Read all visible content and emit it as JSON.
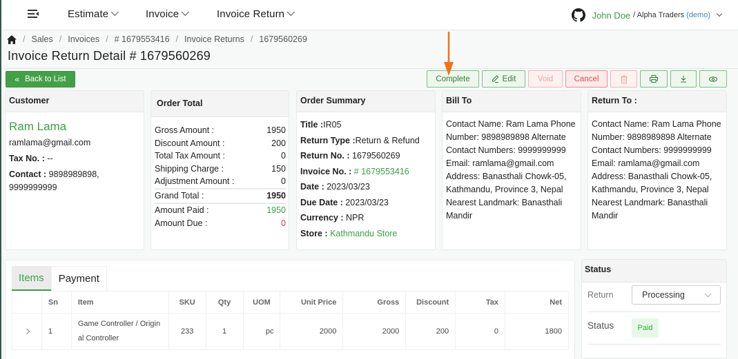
{
  "topnav": {
    "menus": [
      {
        "label": "Estimate"
      },
      {
        "label": "Invoice"
      },
      {
        "label": "Invoice Return"
      }
    ],
    "user": {
      "name": "John Doe",
      "org": "/ Alpha Traders",
      "demo": "(demo)"
    }
  },
  "breadcrumb": [
    "Sales",
    "Invoices",
    "# 1679553416",
    "Invoice Returns",
    "1679560269"
  ],
  "page_title": "Invoice Return Detail # 1679560269",
  "toolbar": {
    "back_label": "Back to List",
    "complete_label": "Complete",
    "edit_label": "Edit",
    "void_label": "Void",
    "cancel_label": "Cancel"
  },
  "customer": {
    "heading": "Customer",
    "name": "Ram Lama",
    "email": "ramlama@gmail.com",
    "tax_label": "Tax No. :",
    "tax_value": " --",
    "contact_label": "Contact :",
    "contact_value": " 9898989898, 9999999999"
  },
  "order_total": {
    "heading": "Order Total",
    "rows": [
      {
        "label": "Gross Amount :",
        "value": "1950"
      },
      {
        "label": "Discount Amount :",
        "value": "200"
      },
      {
        "label": "Total Tax Amount :",
        "value": "0"
      },
      {
        "label": "Shipping Charge :",
        "value": "150"
      },
      {
        "label": "Adjustment Amount :",
        "value": "0"
      }
    ],
    "grand_total": {
      "label": "Grand Total :",
      "value": "1950"
    },
    "amount_paid": {
      "label": "Amount Paid :",
      "value": "1950"
    },
    "amount_due": {
      "label": "Amount Due :",
      "value": "0"
    }
  },
  "order_summary": {
    "heading": "Order Summary",
    "title_label": "Title :",
    "title_value": "IR05",
    "return_type_label": "Return Type :",
    "return_type_value": "Return & Refund",
    "return_no_label": "Return No. :",
    "return_no_value": " 1679560269",
    "invoice_no_label": "Invoice No. :",
    "invoice_no_value": " # 1679553416",
    "date_label": "Date :",
    "date_value": " 2023/03/23",
    "due_date_label": "Due Date :",
    "due_date_value": " 2023/03/23",
    "currency_label": "Currency :",
    "currency_value": " NPR",
    "store_label": "Store :",
    "store_value": " Kathmandu Store"
  },
  "bill_to": {
    "heading": "Bill To",
    "lines": [
      "Contact Name: Ram Lama Phone",
      "Number: 9898989898 Alternate",
      "Contact Numbers: 9999999999",
      "Email: ramlama@gmail.com",
      "Address: Banasthali Chowk-05,",
      "Kathmandu, Province 3, Nepal",
      "Nearest Landmark: Banasthali",
      "Mandir"
    ]
  },
  "return_to": {
    "heading": "Return To :",
    "lines": [
      "Contact Name: Ram Lama Phone",
      "Number: 9898989898 Alternate",
      "Contact Numbers: 9999999999",
      "Email: ramlama@gmail.com",
      "Address: Banasthali Chowk-05,",
      "Kathmandu, Province 3, Nepal",
      "Nearest Landmark: Banasthali",
      "Mandir"
    ]
  },
  "tabs": [
    {
      "label": "Items",
      "active": true
    },
    {
      "label": "Payment",
      "active": false
    }
  ],
  "items_table": {
    "headers": [
      "",
      "Sn",
      "Item",
      "SKU",
      "Qty",
      "UOM",
      "Unit Price",
      "Gross",
      "Discount",
      "Tax",
      "Net"
    ],
    "rows": [
      {
        "sn": "1",
        "item_line1": "Game Controller / Origin",
        "item_line2": "al Controller",
        "sku": "233",
        "qty": "1",
        "uom": "pc",
        "unit_price": "2000",
        "gross": "2000",
        "discount": "200",
        "tax": "0",
        "net": "1800"
      }
    ]
  },
  "status_panel": {
    "heading": "Status",
    "return_label": "Return",
    "return_value": "Processing",
    "status_label": "Status",
    "status_value": "Paid"
  },
  "colors": {
    "brand_green": "#43a047",
    "accent_green": "#3aa047",
    "danger_red": "#e0374b",
    "annotation_arrow": "#f07316"
  }
}
